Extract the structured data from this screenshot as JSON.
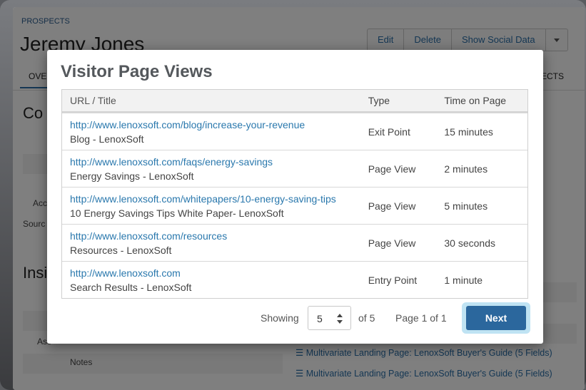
{
  "background": {
    "breadcrumb": "PROSPECTS",
    "title": "Jeremy Jones",
    "actions": [
      "Edit",
      "Delete",
      "Show Social Data"
    ],
    "tab_left": "OVE",
    "tab_right": "ECTS",
    "section1": "Co",
    "section2": "Insi",
    "labels": [
      "Acc",
      "Sourc",
      "Ass",
      "Notes"
    ],
    "links": [
      "Multivariate Landing Page: LenoxSoft Buyer's Guide (5 Fields)",
      "Multivariate Landing Page: LenoxSoft Buyer's Guide (5 Fields)"
    ]
  },
  "modal": {
    "title": "Visitor Page Views",
    "columns": [
      "URL / Title",
      "Type",
      "Time on Page"
    ],
    "rows": [
      {
        "url": "http://www.lenoxsoft.com/blog/increase-your-revenue",
        "title": "Blog - LenoxSoft",
        "type": "Exit Point",
        "time": "15 minutes"
      },
      {
        "url": "http://www.lenoxsoft.com/faqs/energy-savings",
        "title": "Energy Savings - LenoxSoft",
        "type": "Page View",
        "time": "2 minutes"
      },
      {
        "url": "http://www.lenoxsoft.com/whitepapers/10-energy-saving-tips",
        "title": "10 Energy Savings Tips White Paper- LenoxSoft",
        "type": "Page View",
        "time": "5 minutes"
      },
      {
        "url": "http://www.lenoxsoft.com/resources",
        "title": "Resources - LenoxSoft",
        "type": "Page View",
        "time": "30 seconds"
      },
      {
        "url": "http://www.lenoxsoft.com",
        "title": "Search Results - LenoxSoft",
        "type": "Entry Point",
        "time": "1 minute"
      }
    ],
    "footer": {
      "showing_label": "Showing",
      "page_size": "5",
      "of_total": "of 5",
      "page_info": "Page 1 of 1",
      "next_label": "Next"
    }
  }
}
